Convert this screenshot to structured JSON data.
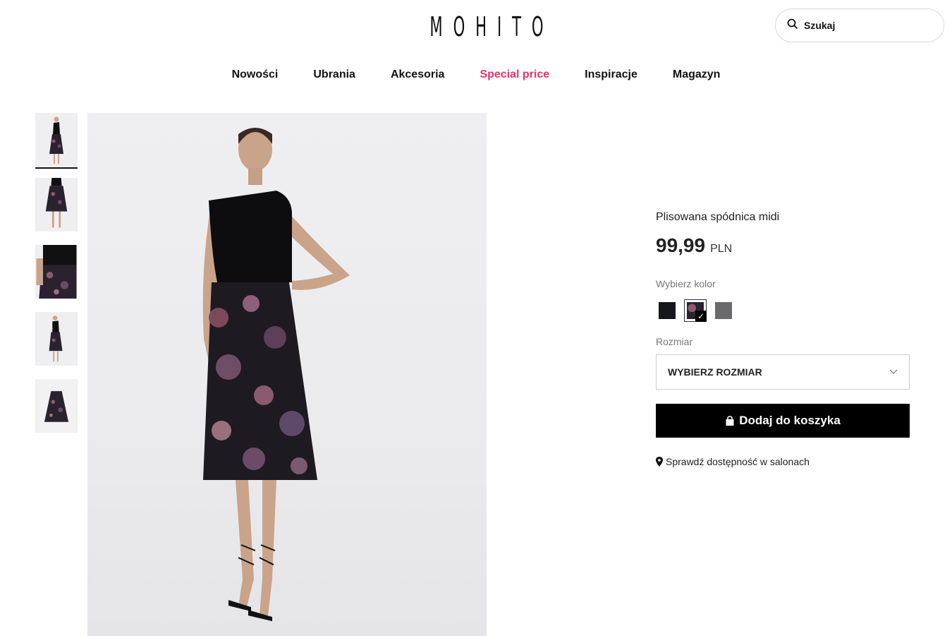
{
  "header": {
    "logo": "MOHITO",
    "search_placeholder": "Szukaj"
  },
  "nav": {
    "items": [
      {
        "label": "Nowości"
      },
      {
        "label": "Ubrania"
      },
      {
        "label": "Akcesoria"
      },
      {
        "label": "Special price",
        "accent": true
      },
      {
        "label": "Inspiracje"
      },
      {
        "label": "Magazyn"
      }
    ]
  },
  "gallery": {
    "thumbnail_count": 5,
    "active_thumbnail": 1
  },
  "product": {
    "name": "Plisowana spódnica midi",
    "price": "99,99",
    "currency": "PLN",
    "color_label": "Wybierz kolor",
    "colors": [
      {
        "color": "#15171b",
        "selected": false
      },
      {
        "color": "#3a2a38",
        "selected": true
      },
      {
        "color": "#6a6a6c",
        "selected": false
      }
    ],
    "size_label": "Rozmiar",
    "size_select": "WYBIERZ ROZMIAR",
    "add_to_cart": "Dodaj do koszyka",
    "availability": "Sprawdź dostępność w salonach"
  },
  "colors": {
    "accent": "#e8336d",
    "button": "#000000"
  }
}
